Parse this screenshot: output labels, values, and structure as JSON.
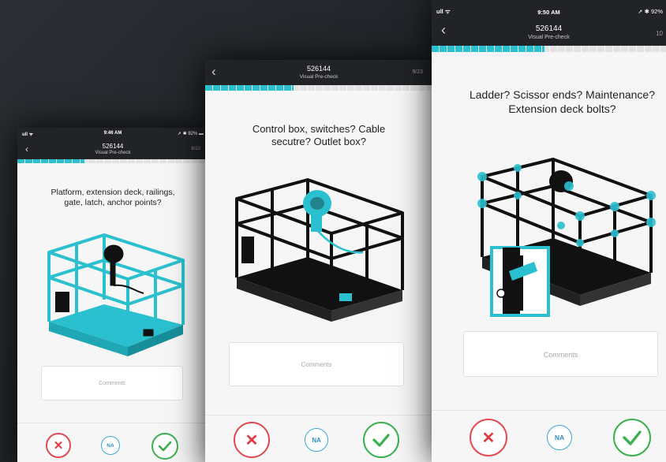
{
  "app": {
    "colors": {
      "accent": "#2bc0cf",
      "dark_bar": "#212326",
      "no": "#e04b53",
      "na": "#3aa6d6",
      "yes": "#3bb04f"
    }
  },
  "screens": [
    {
      "status": {
        "time": "9:46 AM",
        "signal": "ull",
        "battery": "92%"
      },
      "nav": {
        "back_icon": "chevron-left-icon",
        "title": "526144",
        "subtitle": "Visual Pre-check",
        "count": "8/23"
      },
      "progress": 0.35,
      "question": "Platform, extension deck, railings, gate, latch, anchor points?",
      "comments_placeholder": "Comments",
      "actions": {
        "no_icon": "close-icon",
        "na_label": "NA",
        "yes_icon": "check-icon"
      }
    },
    {
      "nav": {
        "back_icon": "chevron-left-icon",
        "title": "526144",
        "subtitle": "Visual Pre-check",
        "count": "9/23"
      },
      "progress": 0.39,
      "question": "Control box, switches? Cable secutre? Outlet box?",
      "comments_placeholder": "Comments",
      "actions": {
        "no_icon": "close-icon",
        "na_label": "NA",
        "yes_icon": "check-icon"
      }
    },
    {
      "status": {
        "time": "9:50 AM",
        "signal": "ull",
        "battery": "92%"
      },
      "nav": {
        "back_icon": "chevron-left-icon",
        "title": "526144",
        "subtitle": "Visual Pre-check",
        "count": "10"
      },
      "progress": 0.48,
      "question": "Ladder? Scissor ends? Maintenance? Extension deck bolts?",
      "comments_placeholder": "Comments",
      "actions": {
        "no_icon": "close-icon",
        "na_label": "NA",
        "yes_icon": "check-icon"
      }
    }
  ]
}
